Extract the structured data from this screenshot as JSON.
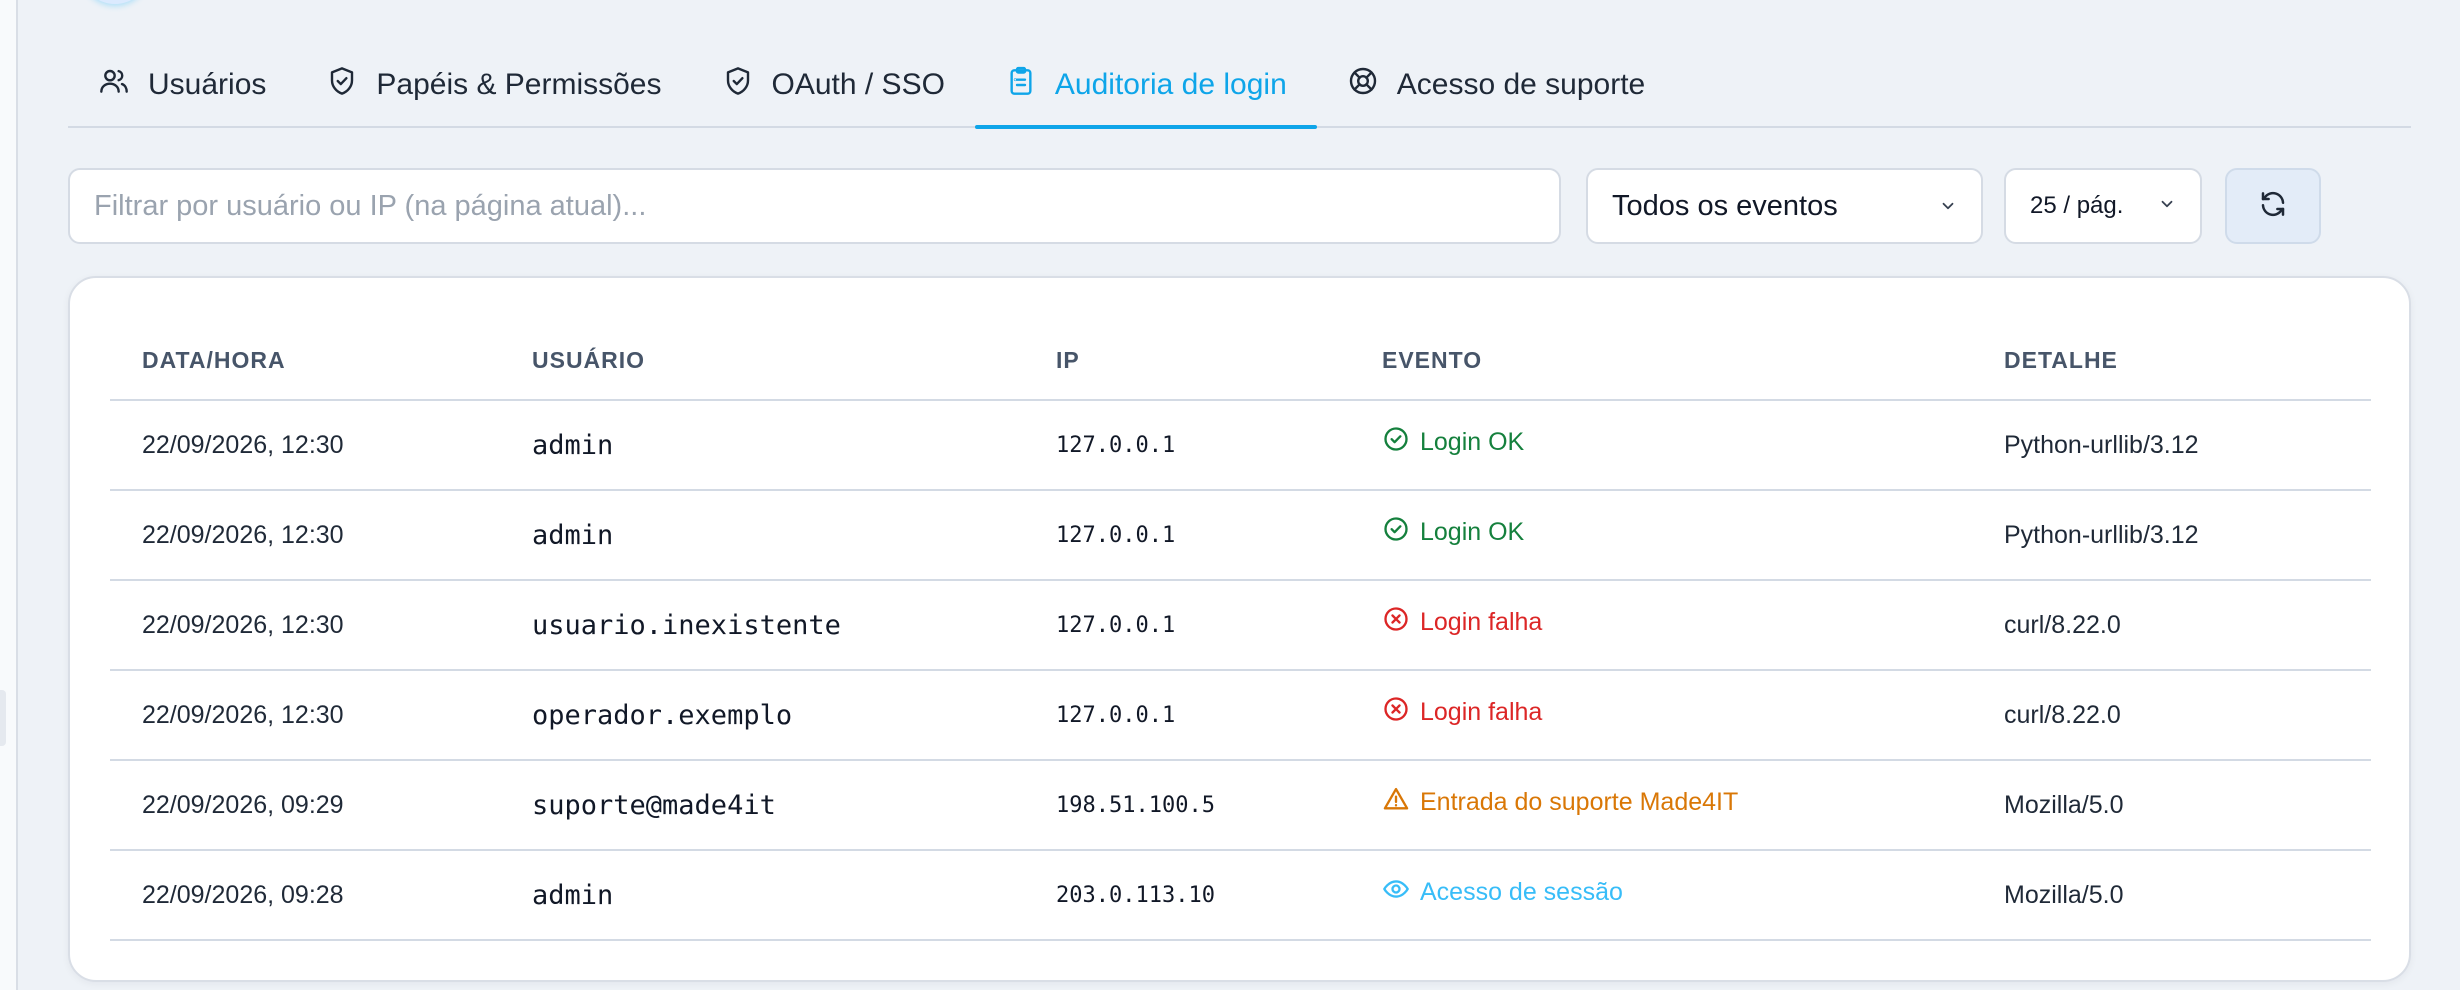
{
  "tabs": [
    {
      "label": "Usuários",
      "icon": "users-icon"
    },
    {
      "label": "Papéis & Permissões",
      "icon": "shield-check-icon"
    },
    {
      "label": "OAuth / SSO",
      "icon": "shield-check-icon"
    },
    {
      "label": "Auditoria de login",
      "icon": "clipboard-list-icon",
      "active": true
    },
    {
      "label": "Acesso de suporte",
      "icon": "lifebuoy-icon"
    }
  ],
  "toolbar": {
    "search_placeholder": "Filtrar por usuário ou IP (na página atual)...",
    "search_value": "",
    "event_filter": "Todos os eventos",
    "page_size": "25 / pág.",
    "refresh_icon": "refresh-icon"
  },
  "table": {
    "headers": [
      "DATA/HORA",
      "USUÁRIO",
      "IP",
      "EVENTO",
      "DETALHE"
    ],
    "rows": [
      {
        "datetime": "22/09/2026, 12:30",
        "user": "admin",
        "ip": "127.0.0.1",
        "event": "Login OK",
        "event_type": "ok",
        "detail": "Python-urllib/3.12"
      },
      {
        "datetime": "22/09/2026, 12:30",
        "user": "admin",
        "ip": "127.0.0.1",
        "event": "Login OK",
        "event_type": "ok",
        "detail": "Python-urllib/3.12"
      },
      {
        "datetime": "22/09/2026, 12:30",
        "user": "usuario.inexistente",
        "ip": "127.0.0.1",
        "event": "Login falha",
        "event_type": "fail",
        "detail": "curl/8.22.0"
      },
      {
        "datetime": "22/09/2026, 12:30",
        "user": "operador.exemplo",
        "ip": "127.0.0.1",
        "event": "Login falha",
        "event_type": "fail",
        "detail": "curl/8.22.0"
      },
      {
        "datetime": "22/09/2026, 09:29",
        "user": "suporte@made4it",
        "ip": "198.51.100.5",
        "event": "Entrada do suporte Made4IT",
        "event_type": "warn",
        "detail": "Mozilla/5.0"
      },
      {
        "datetime": "22/09/2026, 09:28",
        "user": "admin",
        "ip": "203.0.113.10",
        "event": "Acesso de sessão",
        "event_type": "info",
        "detail": "Mozilla/5.0"
      }
    ]
  },
  "colors": {
    "accent": "#0ea5e9",
    "ok": "#15803d",
    "fail": "#dc2626",
    "warn": "#d97706",
    "info": "#38bdf8"
  }
}
